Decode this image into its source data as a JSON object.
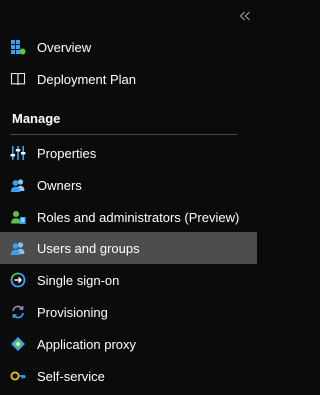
{
  "collapse_label": "«",
  "primary_items": [
    {
      "label": "Overview",
      "icon": "overview-grid-icon"
    },
    {
      "label": "Deployment Plan",
      "icon": "book-icon"
    }
  ],
  "manage": {
    "header": "Manage",
    "items": [
      {
        "label": "Properties",
        "icon": "properties-sliders-icon"
      },
      {
        "label": "Owners",
        "icon": "owners-people-icon"
      },
      {
        "label": "Roles and administrators (Preview)",
        "icon": "roles-admin-icon"
      },
      {
        "label": "Users and groups",
        "icon": "users-groups-icon",
        "selected": true
      },
      {
        "label": "Single sign-on",
        "icon": "single-sign-on-icon"
      },
      {
        "label": "Provisioning",
        "icon": "provisioning-sync-icon"
      },
      {
        "label": "Application proxy",
        "icon": "application-proxy-icon"
      },
      {
        "label": "Self-service",
        "icon": "self-service-key-icon"
      }
    ]
  },
  "colors": {
    "background": "#0b0b0b",
    "selected_row": "#4d4d4d",
    "accent_blue": "#3aa0f3",
    "accent_green": "#5fc34a"
  }
}
